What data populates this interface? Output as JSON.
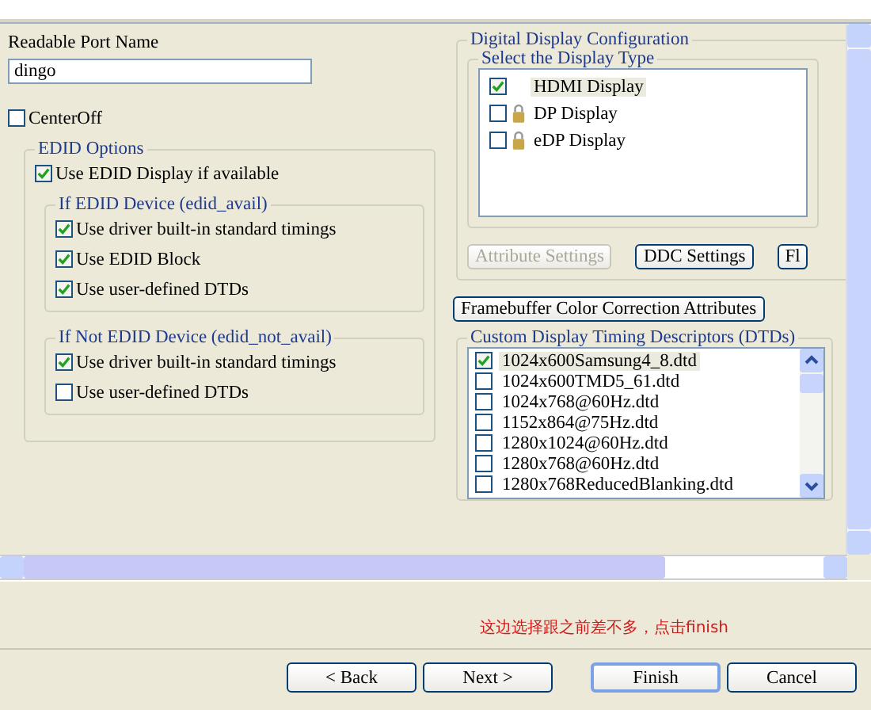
{
  "port_name": {
    "label": "Readable Port Name",
    "value": "dingo"
  },
  "center_off": {
    "label": "CenterOff",
    "checked": false
  },
  "edid_options": {
    "title": "EDID Options",
    "use_edid": {
      "label": "Use EDID Display if available",
      "checked": true
    },
    "groups": [
      {
        "title": "If EDID Device (edid_avail)",
        "options": [
          {
            "label": "Use driver built-in standard timings",
            "checked": true
          },
          {
            "label": "Use EDID Block",
            "checked": true
          },
          {
            "label": "Use user-defined DTDs",
            "checked": true
          }
        ]
      },
      {
        "title": "If Not EDID Device (edid_not_avail)",
        "options": [
          {
            "label": "Use driver built-in standard timings",
            "checked": true
          },
          {
            "label": "Use user-defined DTDs",
            "checked": false
          }
        ]
      }
    ]
  },
  "digital_display": {
    "title": "Digital Display Configuration",
    "type_group": {
      "title": "Select the Display Type",
      "items": [
        {
          "label": "HDMI Display",
          "checked": true,
          "locked": false,
          "selected": true
        },
        {
          "label": "DP Display",
          "checked": false,
          "locked": true,
          "selected": false
        },
        {
          "label": "eDP Display",
          "checked": false,
          "locked": true,
          "selected": false
        }
      ]
    },
    "buttons": [
      {
        "label": "Attribute Settings",
        "disabled": true
      },
      {
        "label": "DDC Settings",
        "disabled": false
      },
      {
        "label": "Fl",
        "disabled": false
      }
    ]
  },
  "framebuffer_button": "Framebuffer Color Correction Attributes",
  "dtds": {
    "title": "Custom Display Timing Descriptors (DTDs)",
    "items": [
      {
        "label": "1024x600Samsung4_8.dtd",
        "checked": true,
        "selected": true
      },
      {
        "label": "1024x600TMD5_61.dtd",
        "checked": false,
        "selected": false
      },
      {
        "label": "1024x768@60Hz.dtd",
        "checked": false,
        "selected": false
      },
      {
        "label": "1152x864@75Hz.dtd",
        "checked": false,
        "selected": false
      },
      {
        "label": "1280x1024@60Hz.dtd",
        "checked": false,
        "selected": false
      },
      {
        "label": "1280x768@60Hz.dtd",
        "checked": false,
        "selected": false
      },
      {
        "label": "1280x768ReducedBlanking.dtd",
        "checked": false,
        "selected": false
      }
    ]
  },
  "note": "这边选择跟之前差不多，点击finish",
  "buttons": [
    {
      "label": "< Back",
      "default": false
    },
    {
      "label": "Next >",
      "default": false
    },
    {
      "label": "Finish",
      "default": true
    },
    {
      "label": "Cancel",
      "default": false
    }
  ]
}
